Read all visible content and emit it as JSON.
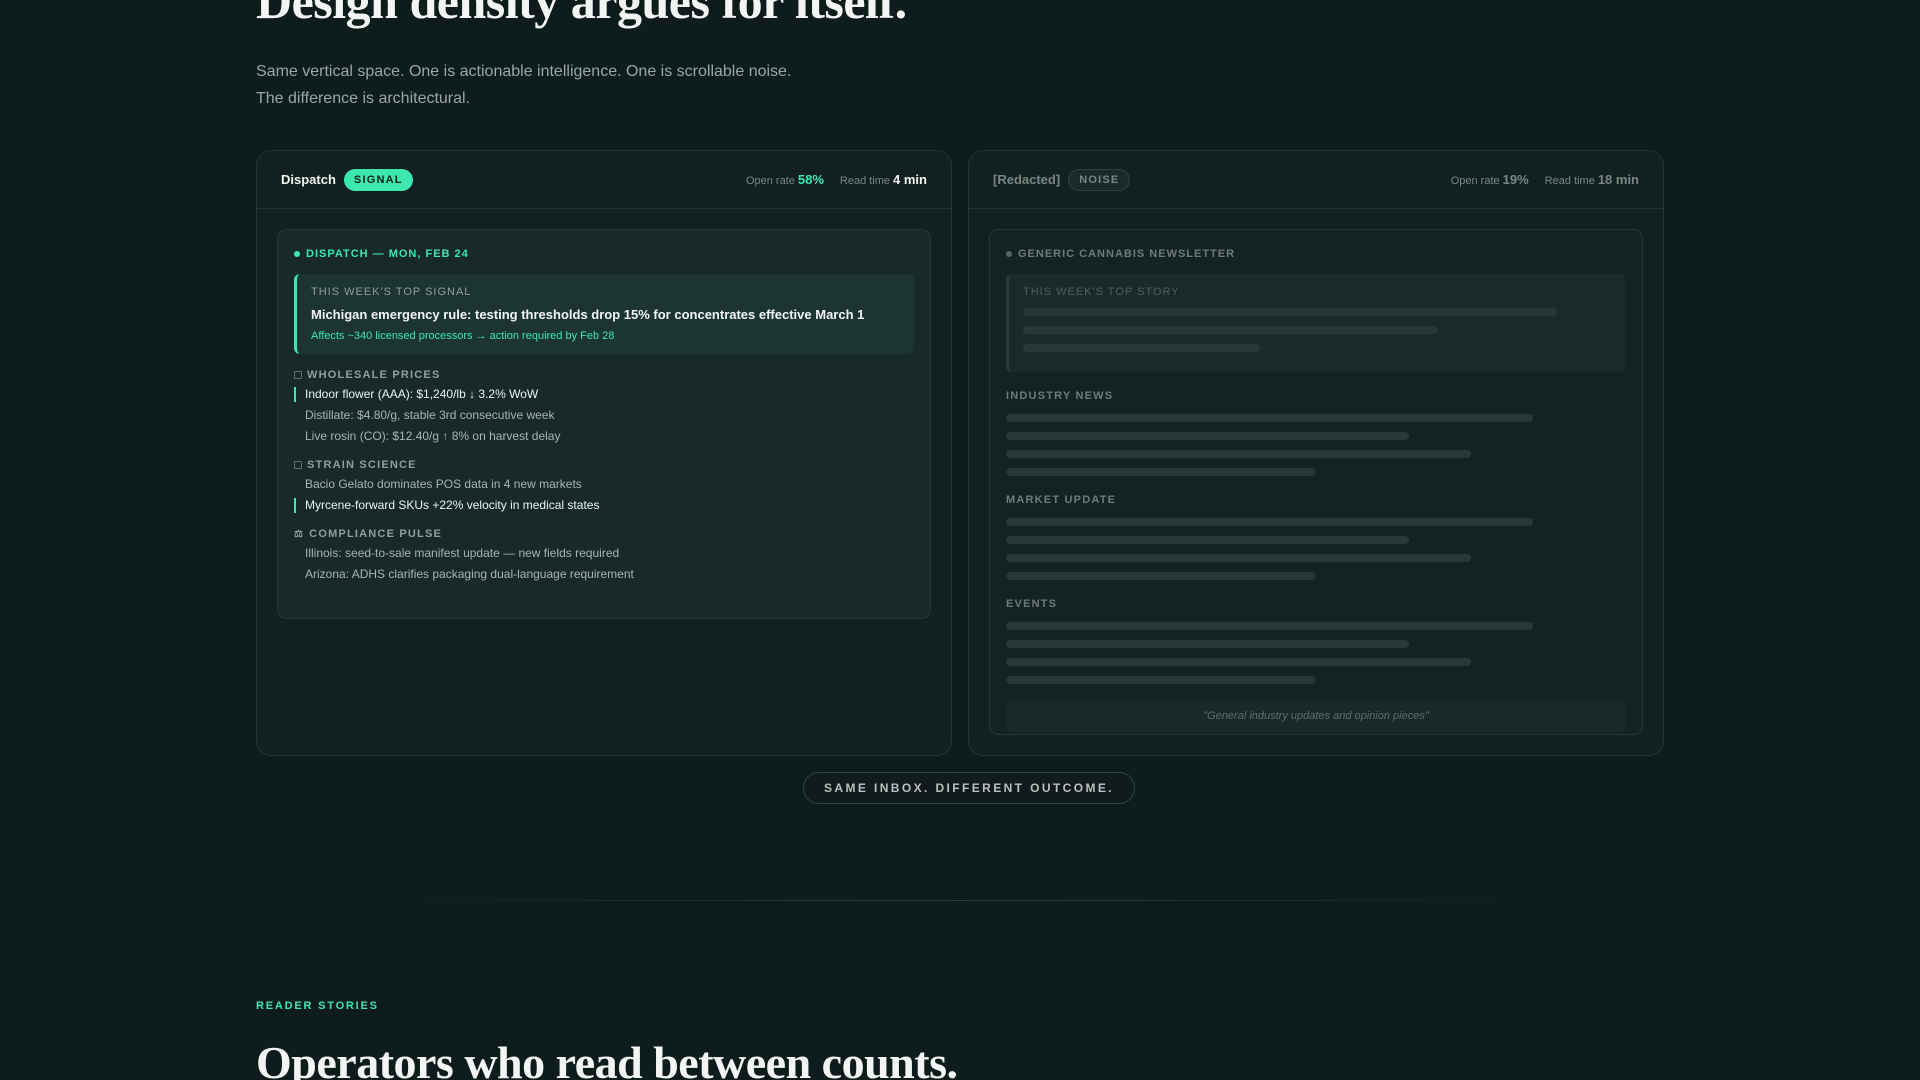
{
  "hero": {
    "title": "Design density argues for itself.",
    "subtitle_line1": "Same vertical space. One is actionable intelligence. One is scrollable noise.",
    "subtitle_line2": "The difference is architectural."
  },
  "signal_card": {
    "brand": "Dispatch",
    "badge": "SIGNAL",
    "open_rate_label": "Open rate",
    "open_rate": "58%",
    "read_time_label": "Read time",
    "read_time": "4 min",
    "kicker": "DISPATCH — MON, FEB 24",
    "top_label": "THIS WEEK'S TOP SIGNAL",
    "top_title": "Michigan emergency rule: testing thresholds drop 15% for concentrates effective March 1",
    "top_sub": "Affects ~340 licensed processors → action required by Feb 28",
    "sections": [
      {
        "label": "WHOLESALE PRICES",
        "items": [
          "Indoor flower (AAA): $1,240/lb ↓ 3.2% WoW",
          "Distillate: $4.80/g, stable 3rd consecutive week",
          "Live rosin (CO): $12.40/g ↑ 8% on harvest delay"
        ]
      },
      {
        "label": "STRAIN SCIENCE",
        "items": [
          "Bacio Gelato dominates POS data in 4 new markets",
          "Myrcene-forward SKUs +22% velocity in medical states"
        ]
      },
      {
        "label": "COMPLIANCE PULSE",
        "items": [
          "Illinois: seed-to-sale manifest update — new fields required",
          "Arizona: ADHS clarifies packaging dual-language requirement"
        ]
      }
    ]
  },
  "noise_card": {
    "brand": "[Redacted]",
    "badge": "NOISE",
    "open_rate_label": "Open rate",
    "open_rate": "19%",
    "read_time_label": "Read time",
    "read_time": "18 min",
    "kicker": "GENERIC CANNABIS NEWSLETTER",
    "top_label": "THIS WEEK'S TOP STORY",
    "sections": [
      "INDUSTRY NEWS",
      "MARKET UPDATE",
      "EVENTS"
    ],
    "quote": "\"General industry updates and opinion pieces\""
  },
  "outcome": "SAME INBOX. DIFFERENT OUTCOME.",
  "reader_stories": {
    "eyebrow": "READER STORIES",
    "title": "Operators who read between counts."
  },
  "colors": {
    "accent": "#3ee6b0",
    "background": "#0f1c1c"
  }
}
